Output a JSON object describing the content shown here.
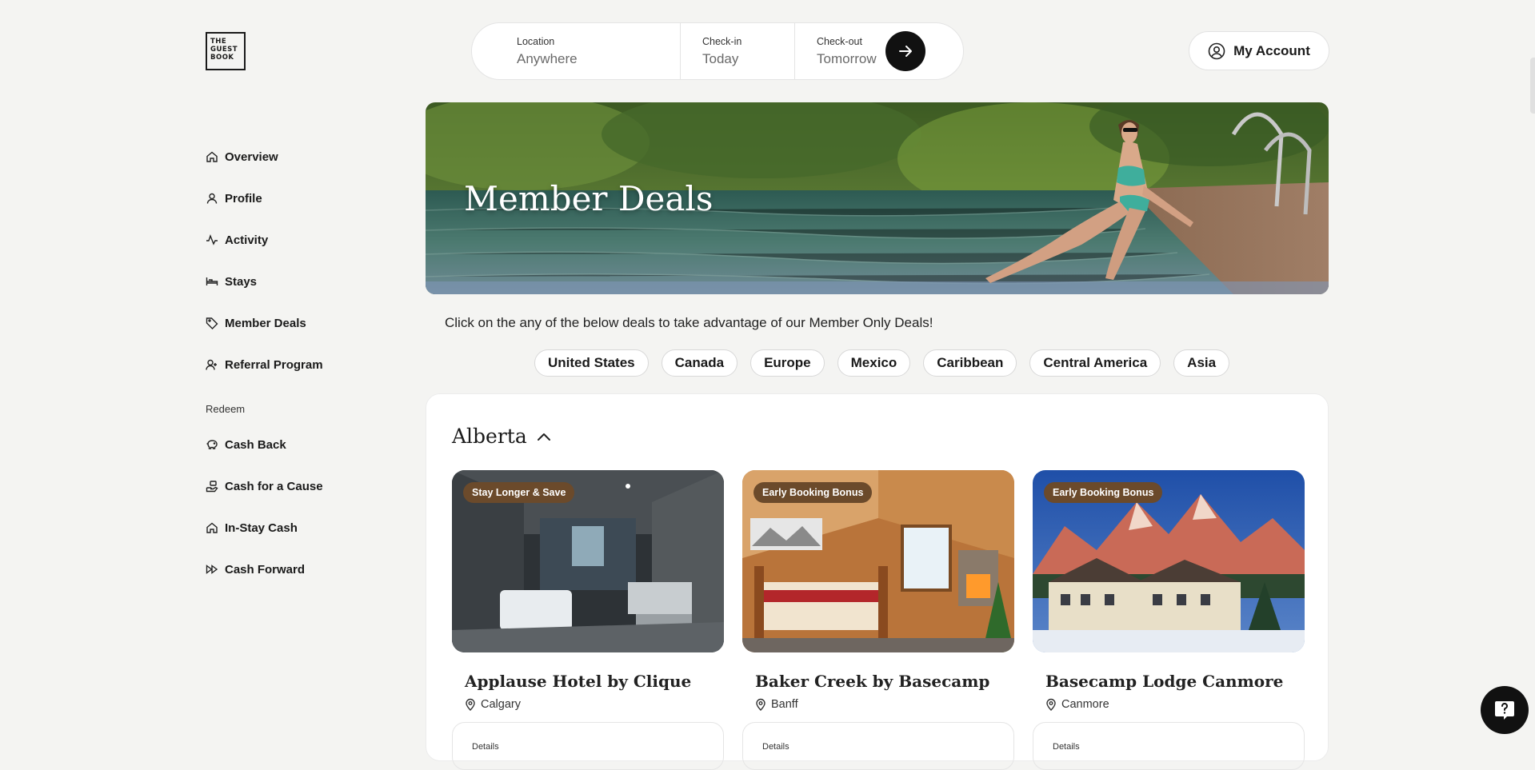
{
  "brand": {
    "logo_lines": [
      "THE",
      "GUEST",
      "BOOK"
    ]
  },
  "nav": {
    "items": [
      {
        "label": "Overview",
        "icon": "home-icon"
      },
      {
        "label": "Profile",
        "icon": "user-icon"
      },
      {
        "label": "Activity",
        "icon": "activity-icon"
      },
      {
        "label": "Stays",
        "icon": "bed-icon"
      },
      {
        "label": "Member Deals",
        "icon": "tag-icon"
      },
      {
        "label": "Referral Program",
        "icon": "user-plus-icon"
      }
    ],
    "section_label": "Redeem",
    "redeem_items": [
      {
        "label": "Cash Back",
        "icon": "piggy-bank-icon"
      },
      {
        "label": "Cash for a Cause",
        "icon": "hand-coins-icon"
      },
      {
        "label": "In-Stay Cash",
        "icon": "home-icon"
      },
      {
        "label": "Cash Forward",
        "icon": "fast-forward-icon"
      }
    ]
  },
  "search": {
    "location_label": "Location",
    "location_value": "Anywhere",
    "checkin_label": "Check-in",
    "checkin_value": "Today",
    "checkout_label": "Check-out",
    "checkout_value": "Tomorrow"
  },
  "account": {
    "label": "My Account"
  },
  "hero": {
    "title": "Member Deals"
  },
  "intro": "Click on the any of the below deals to take advantage of our Member Only Deals!",
  "regions": [
    "United States",
    "Canada",
    "Europe",
    "Mexico",
    "Caribbean",
    "Central America",
    "Asia"
  ],
  "section": {
    "title": "Alberta",
    "cards": [
      {
        "badge": "Stay Longer & Save",
        "name": "Applause Hotel by Clique",
        "location": "Calgary",
        "details": "Details"
      },
      {
        "badge": "Early Booking Bonus",
        "name": "Baker Creek by Basecamp",
        "location": "Banff",
        "details": "Details"
      },
      {
        "badge": "Early Booking Bonus",
        "name": "Basecamp Lodge Canmore",
        "location": "Canmore",
        "details": "Details"
      }
    ]
  },
  "colors": {
    "accent": "#111111",
    "badge": "#6b4a2b",
    "background": "#f4f4f2"
  }
}
